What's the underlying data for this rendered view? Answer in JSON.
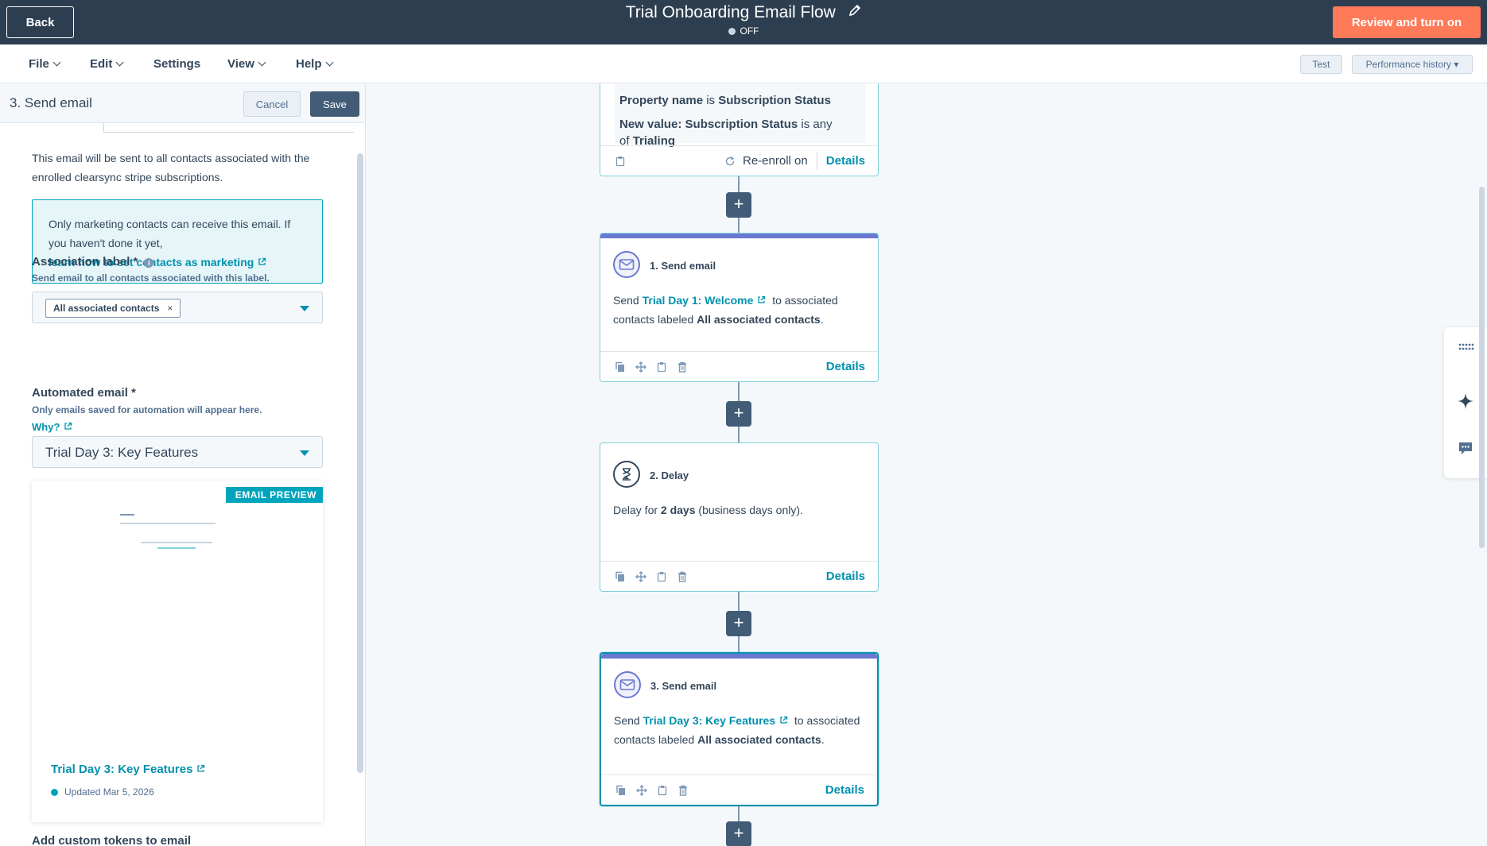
{
  "topbar": {
    "back_label": "Back",
    "title": "Trial Onboarding Email Flow",
    "status": "OFF",
    "review_label": "Review and turn on"
  },
  "menu": {
    "items": [
      "File",
      "Edit",
      "Settings",
      "View",
      "Help"
    ],
    "test_label": "Test",
    "performance_label": "Performance history"
  },
  "panel": {
    "title": "3. Send email",
    "cancel_label": "Cancel",
    "save_label": "Save",
    "description": "This email will be sent to all contacts associated with the enrolled clearsync stripe subscriptions.",
    "info_text": "Only marketing contacts can receive this email. If you haven't done it yet,",
    "info_link": "learn how to set contacts as marketing",
    "association_label": "Association label *",
    "association_help": "Send email to all contacts associated with this label.",
    "association_tag": "All associated contacts",
    "automated_label": "Automated email *",
    "automated_help": "Only emails saved for automation will appear here.",
    "why_link": "Why?",
    "automated_value": "Trial Day 3: Key Features",
    "preview_badge": "EMAIL PREVIEW",
    "preview_name": "Trial Day 3: Key Features",
    "preview_updated": "Updated Mar 5, 2026",
    "custom_tokens": "Add custom tokens to email"
  },
  "trigger": {
    "line1_a": "Property name",
    "line1_b": "is",
    "line1_c": "Subscription Status",
    "line2_a": "New value: Subscription Status",
    "line2_b": "is any",
    "line3_a": "of",
    "line3_b": "Trialing",
    "reenroll": "Re-enroll on",
    "details": "Details"
  },
  "nodes": [
    {
      "head": "1. Send email",
      "send": "Send",
      "link": "Trial Day 1: Welcome",
      "rest": "to associated contacts labeled",
      "bold": "All associated contacts",
      "end": ".",
      "details": "Details"
    },
    {
      "head": "2. Delay",
      "pre": "Delay for",
      "bold": "2 days",
      "post": "(business days only).",
      "details": "Details"
    },
    {
      "head": "3. Send email",
      "send": "Send",
      "link": "Trial Day 3: Key Features",
      "rest": "to associated contacts labeled",
      "bold": "All associated contacts",
      "end": ".",
      "details": "Details"
    }
  ],
  "colors": {
    "topbar": "#2d3e50",
    "accent": "#ff7a59",
    "link": "#0091ae",
    "action_purple": "#6a78d1"
  }
}
